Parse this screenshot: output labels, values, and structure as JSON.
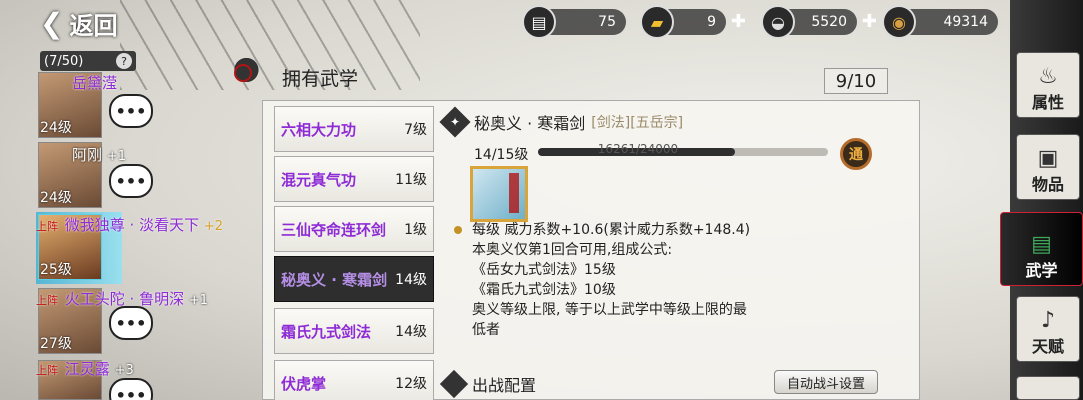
{
  "top": {
    "back_label": "返回",
    "resources": [
      {
        "icon": "scroll-icon",
        "value": "75",
        "has_plus": false
      },
      {
        "icon": "gold-bar-icon",
        "value": "9",
        "has_plus": true
      },
      {
        "icon": "silver-ingot-icon",
        "value": "5520",
        "has_plus": true
      },
      {
        "icon": "coin-icon",
        "value": "49314",
        "has_plus": false
      }
    ]
  },
  "heroes": {
    "count": "(7/50)",
    "help": "?",
    "list": [
      {
        "name": "岳黛滢",
        "level": "24级",
        "deployed": false,
        "bonus": ""
      },
      {
        "name": "阿刚",
        "level": "24级",
        "deployed": false,
        "bonus": "+1"
      },
      {
        "name": "微我独尊 · 淡看天下",
        "level": "25级",
        "deployed": true,
        "bonus": "+2",
        "selected": true
      },
      {
        "name": "火工头陀 · 鲁明深",
        "level": "27级",
        "deployed": true,
        "bonus": "+1"
      },
      {
        "name": "江灵露",
        "level": "",
        "deployed": true,
        "bonus": "+3"
      }
    ],
    "deployed_label": "上阵",
    "chat_glyph": "•••"
  },
  "panel": {
    "title": "拥有武学",
    "count": "9/10",
    "skills": [
      {
        "name": "六相大力功",
        "level": "7级"
      },
      {
        "name": "混元真气功",
        "level": "11级"
      },
      {
        "name": "三仙夺命连环剑",
        "level": "1级"
      },
      {
        "name": "秘奥义 · 寒霜剑",
        "level": "14级",
        "active": true
      },
      {
        "name": "霜氏九式剑法",
        "level": "14级"
      },
      {
        "name": "伏虎掌",
        "level": "12级"
      }
    ]
  },
  "detail": {
    "name": "秘奥义 · 寒霜剑",
    "tags": "[剑法][五岳宗]",
    "level": "14/15级",
    "exp_text": "16261/24000",
    "exp_progress": 0.68,
    "badge": "通",
    "lines": [
      "每级  威力系数+10.6(累计威力系数+148.4)",
      "本奥义仅第1回合可用,组成公式:",
      "《岳女九式剑法》15级",
      "《霜氏九式剑法》10级",
      "奥义等级上限, 等于以上武学中等级上限的最",
      "低者"
    ],
    "footer_title": "出战配置",
    "auto_button": "自动战斗设置"
  },
  "tabs": [
    {
      "label": "属性",
      "icon": "gourd-icon"
    },
    {
      "label": "物品",
      "icon": "box-icon"
    },
    {
      "label": "武学",
      "icon": "scroll-icon",
      "active": true
    },
    {
      "label": "天赋",
      "icon": "flute-icon"
    }
  ]
}
